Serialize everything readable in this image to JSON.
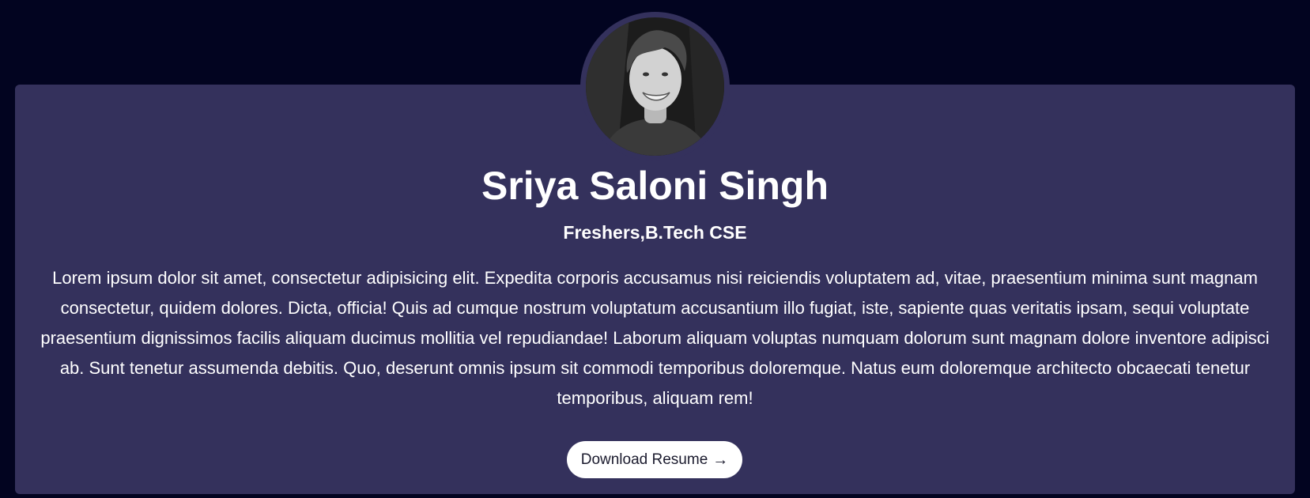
{
  "profile": {
    "name": "Sriya Saloni Singh",
    "subtitle": "Freshers,B.Tech CSE",
    "bio": "Lorem ipsum dolor sit amet, consectetur adipisicing elit. Expedita corporis accusamus nisi reiciendis voluptatem ad, vitae, praesentium minima sunt magnam consectetur, quidem dolores. Dicta, officia! Quis ad cumque nostrum voluptatum accusantium illo fugiat, iste, sapiente quas veritatis ipsam, sequi voluptate praesentium dignissimos facilis aliquam ducimus mollitia vel repudiandae! Laborum aliquam voluptas numquam dolorum sunt magnam dolore inventore adipisci ab. Sunt tenetur assumenda debitis. Quo, deserunt omnis ipsum sit commodi temporibus doloremque. Natus eum doloremque architecto obcaecati tenetur temporibus, aliquam rem!",
    "download_label": "Download Resume",
    "download_icon": "arrow-right-icon",
    "avatar_icon": "profile-photo"
  },
  "colors": {
    "page_background": "#020420",
    "card_background": "#34315c",
    "text": "#ffffff",
    "button_background": "#ffffff",
    "button_text": "#1b1b2e"
  }
}
